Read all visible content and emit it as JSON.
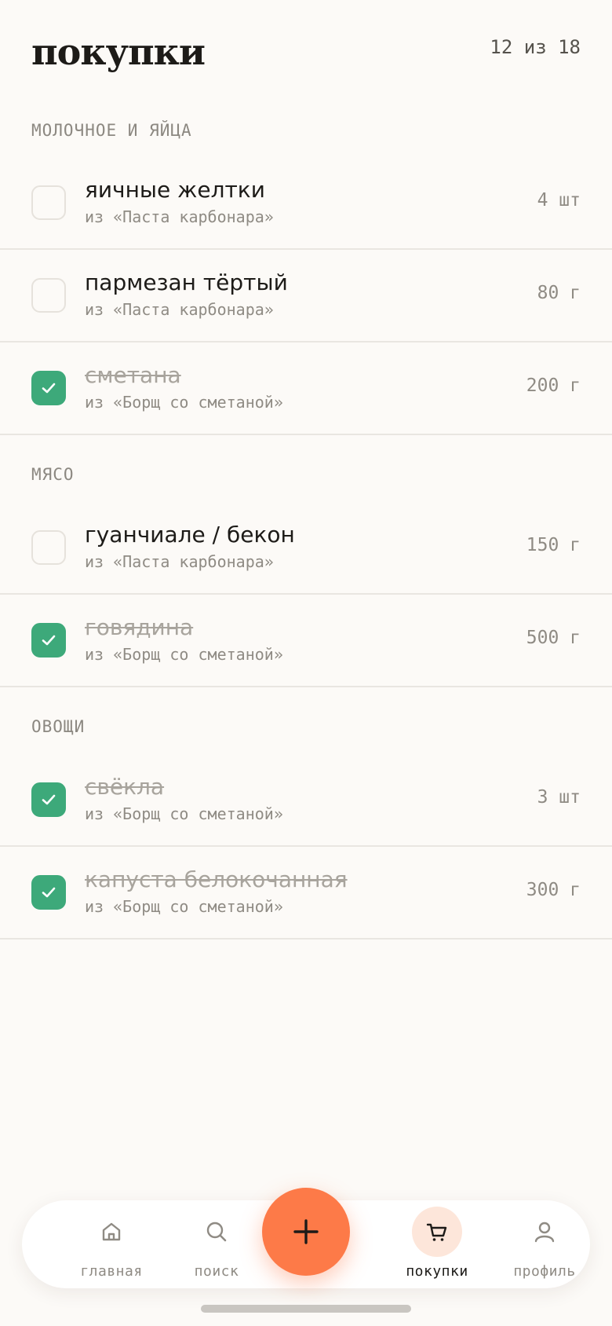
{
  "header": {
    "title": "покупки",
    "progress": "12 из 18"
  },
  "sections": [
    {
      "title": "МОЛОЧНОЕ И ЯЙЦА",
      "items": [
        {
          "name": "яичные желтки",
          "source": "из «Паста карбонара»",
          "qty": "4 шт",
          "checked": false
        },
        {
          "name": "пармезан тёртый",
          "source": "из «Паста карбонара»",
          "qty": "80 г",
          "checked": false
        },
        {
          "name": "сметана",
          "source": "из «Борщ со сметаной»",
          "qty": "200 г",
          "checked": true
        }
      ]
    },
    {
      "title": "МЯСО",
      "items": [
        {
          "name": "гуанчиале / бекон",
          "source": "из «Паста карбонара»",
          "qty": "150 г",
          "checked": false
        },
        {
          "name": "говядина",
          "source": "из «Борщ со сметаной»",
          "qty": "500 г",
          "checked": true
        }
      ]
    },
    {
      "title": "ОВОЩИ",
      "items": [
        {
          "name": "свёкла",
          "source": "из «Борщ со сметаной»",
          "qty": "3 шт",
          "checked": true
        },
        {
          "name": "капуста белокочанная",
          "source": "из «Борщ со сметаной»",
          "qty": "300 г",
          "checked": true
        }
      ]
    }
  ],
  "nav": {
    "items": [
      {
        "label": "главная",
        "icon": "home-icon",
        "active": false
      },
      {
        "label": "поиск",
        "icon": "search-icon",
        "active": false
      },
      {
        "label": "покупки",
        "icon": "cart-icon",
        "active": true
      },
      {
        "label": "профиль",
        "icon": "profile-icon",
        "active": false
      }
    ],
    "fab_icon": "plus-icon"
  },
  "colors": {
    "background": "#fcfaf7",
    "accent": "#fd7a48",
    "checked": "#3da97a",
    "active_nav_bg": "#fde6da"
  }
}
